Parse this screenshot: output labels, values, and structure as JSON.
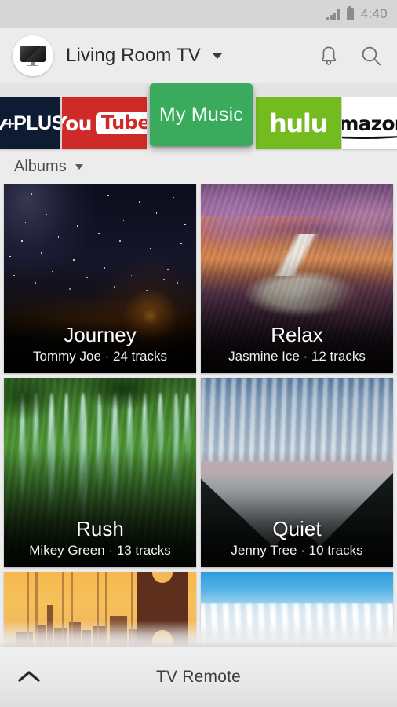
{
  "status_bar": {
    "time": "4:40",
    "signal_icon": "signal-bars-icon",
    "battery_icon": "battery-icon"
  },
  "app_bar": {
    "device_name": "Living Room TV",
    "device_icon": "tv-icon",
    "dropdown_icon": "chevron-down-icon",
    "notifications_icon": "bell-icon",
    "search_icon": "search-icon"
  },
  "tabs": {
    "items": [
      {
        "id": "tvplus",
        "label": "tv+PLUS",
        "active": false,
        "color": "#0d1b33"
      },
      {
        "id": "youtube",
        "label": "You Tube",
        "active": false,
        "color": "#d02a28"
      },
      {
        "id": "mymusic",
        "label": "My Music",
        "active": true,
        "color": "#3aab5c"
      },
      {
        "id": "hulu",
        "label": "hulu",
        "active": false,
        "color": "#74bb20"
      },
      {
        "id": "amazon",
        "label": "amazon",
        "active": false,
        "color": "#ffffff"
      }
    ],
    "youtube_word1": "You",
    "youtube_word2": "Tube",
    "tvplus_part1": "tv",
    "tvplus_plus": "+",
    "tvplus_part2": "PLUS"
  },
  "section": {
    "title": "Albums",
    "caret_icon": "caret-down-icon"
  },
  "albums": [
    {
      "title": "Journey",
      "subtitle": "Tommy Joe · 24 tracks",
      "artist": "Tommy Joe",
      "tracks": "24 tracks",
      "art": "night-sky"
    },
    {
      "title": "Relax",
      "subtitle": "Jasmine Ice · 12 tracks",
      "artist": "Jasmine Ice",
      "tracks": "12 tracks",
      "art": "slot-canyon"
    },
    {
      "title": "Rush",
      "subtitle": "Mikey Green · 13 tracks",
      "artist": "Mikey Green",
      "tracks": "13 tracks",
      "art": "waterfall"
    },
    {
      "title": "Quiet",
      "subtitle": "Jenny Tree  · 10 tracks",
      "artist": "Jenny Tree",
      "tracks": "10 tracks",
      "art": "misty-valley"
    },
    {
      "title": "",
      "subtitle": "",
      "art": "city-skyline"
    },
    {
      "title": "",
      "subtitle": "",
      "art": "cloud-sky"
    }
  ],
  "bottom_bar": {
    "label": "TV Remote",
    "expand_icon": "chevron-up-icon"
  },
  "colors": {
    "accent_green": "#3aab5c",
    "youtube_red": "#d02a28",
    "hulu_green": "#74bb20",
    "tvplus_navy": "#0d1b33",
    "background": "#ececec",
    "status_bar": "#d6d6d6"
  }
}
